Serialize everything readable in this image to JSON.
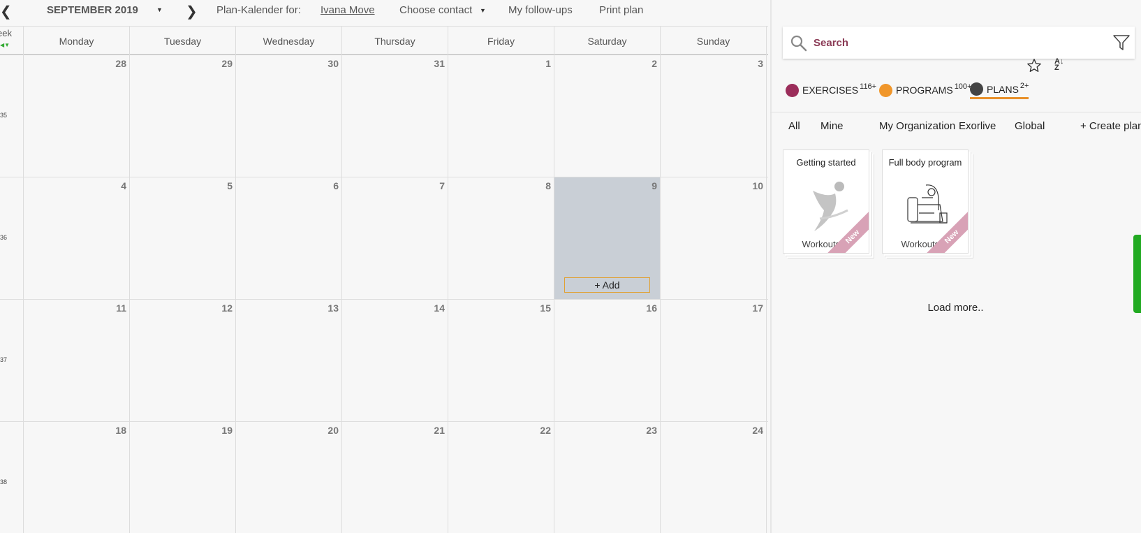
{
  "topbar": {
    "prev_icon": "chevron-left-icon",
    "month": "SEPTEMBER 2019",
    "next_icon": "chevron-right-icon",
    "plan_for_label": "Plan-Kalender for:",
    "contact_name": "Ivana Move",
    "choose_contact": "Choose contact",
    "follow_ups": "My follow-ups",
    "print_plan": "Print plan"
  },
  "calendar": {
    "week_header": "eek",
    "days": [
      "Monday",
      "Tuesday",
      "Wednesday",
      "Thursday",
      "Friday",
      "Saturday",
      "Sunday"
    ],
    "rows": [
      {
        "week": "35",
        "dates": [
          "28",
          "29",
          "30",
          "31",
          "1",
          "2",
          "3"
        ]
      },
      {
        "week": "36",
        "dates": [
          "4",
          "5",
          "6",
          "7",
          "8",
          "9",
          "10"
        ]
      },
      {
        "week": "37",
        "dates": [
          "11",
          "12",
          "13",
          "14",
          "15",
          "16",
          "17"
        ]
      },
      {
        "week": "38",
        "dates": [
          "18",
          "19",
          "20",
          "21",
          "22",
          "23",
          "24"
        ]
      }
    ],
    "selected": {
      "row": 1,
      "col": 5
    },
    "add_label": "+ Add"
  },
  "panel": {
    "search_placeholder": "Search",
    "categories": [
      {
        "label": "EXERCISES",
        "count": "116+",
        "color": "#9b2d5a"
      },
      {
        "label": "PROGRAMS",
        "count": "100+",
        "color": "#f0962a"
      },
      {
        "label": "PLANS",
        "count": "2+",
        "color": "#444444",
        "active": true
      }
    ],
    "filters": [
      "All",
      "Mine",
      "My Organization",
      "Exorlive",
      "Global",
      "+ Create plan ter"
    ],
    "cards": [
      {
        "title": "Getting started",
        "workouts": "Workouts: 6",
        "badge": "New"
      },
      {
        "title": "Full body program",
        "workouts": "Workouts: 5",
        "badge": "New"
      }
    ],
    "load_more": "Load more.."
  },
  "colors": {
    "accent": "#e8902a",
    "selected_day": "#c9cfd6",
    "search_text": "#8a3a55"
  }
}
